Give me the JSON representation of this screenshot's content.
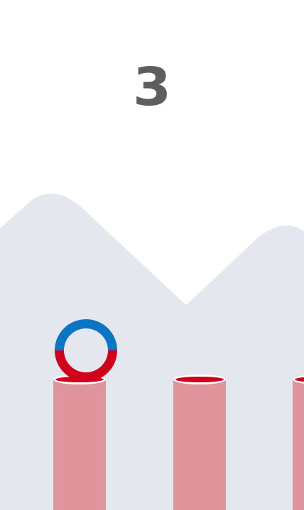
{
  "game": {
    "score": "3"
  },
  "colors": {
    "background": "#ffffff",
    "mountains": "#e4e8ee",
    "score": "#5e5e5e",
    "pillar_body": "#df959b",
    "pillar_rim": "#d0021b",
    "ring_top": "#0a75c2",
    "ring_bottom": "#d0021b"
  },
  "entities": {
    "pillar_count": 3,
    "ball": "two-color-ring"
  }
}
